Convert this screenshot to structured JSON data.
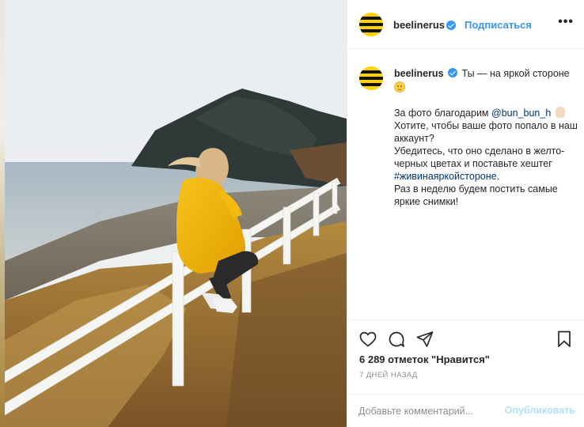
{
  "post": {
    "author": "beelinerus",
    "follow_label": "Подписаться",
    "separator": "•",
    "more_label": "•••"
  },
  "caption": {
    "username": "beelinerus",
    "headline": "Ты — на яркой стороне",
    "line1_prefix": "За фото благодарим",
    "mention": "@bun_bun_h",
    "line1_suffix": "Хотите, чтобы ваше фото попало в наш аккаунт?",
    "line2": "Убедитесь, что оно сделано в желто-черных цветах и поставьте хештег",
    "hashtag": "#живинаяркойстороне",
    "line2_end": ".",
    "line3": "Раз в неделю будем постить самые яркие снимки!"
  },
  "actions": {
    "likes": "6 289 отметок \"Нравится\"",
    "date": "7 дней назад",
    "icons": [
      "heart-icon",
      "comment-icon",
      "share-icon",
      "bookmark-icon"
    ]
  },
  "comment_box": {
    "placeholder": "Добавьте комментарий...",
    "publish_label": "Опубликовать"
  },
  "colors": {
    "brand_yellow": "#ffd200",
    "link_blue": "#3897f0",
    "publish_disabled": "#b2dffc",
    "mention_blue": "#003569"
  }
}
